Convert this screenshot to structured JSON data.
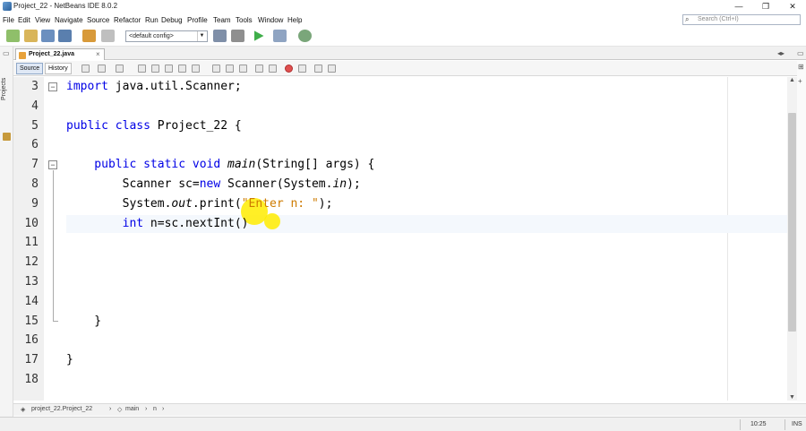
{
  "window": {
    "title": "Project_22 - NetBeans IDE 8.0.2",
    "minimize_glyph": "—",
    "restore_glyph": "❐",
    "close_glyph": "✕"
  },
  "menu": [
    "File",
    "Edit",
    "View",
    "Navigate",
    "Source",
    "Refactor",
    "Run",
    "Debug",
    "Profile",
    "Team",
    "Tools",
    "Window",
    "Help"
  ],
  "search": {
    "placeholder": "Search (Ctrl+I)"
  },
  "toolbar": {
    "config_value": "<default config>"
  },
  "sidebar": {
    "projects_label": "Projects"
  },
  "editor_tab": {
    "label": "Project_22.java",
    "close_glyph": "×"
  },
  "source_bar": {
    "source_label": "Source",
    "history_label": "History"
  },
  "code": {
    "line_numbers": [
      "3",
      "4",
      "5",
      "6",
      "7",
      "8",
      "9",
      "10",
      "11",
      "12",
      "13",
      "14",
      "15",
      "16",
      "17",
      "18"
    ],
    "lines": [
      [
        {
          "t": "import",
          "c": "kw"
        },
        {
          "t": " java.util.Scanner;",
          "c": ""
        }
      ],
      [],
      [
        {
          "t": "public class",
          "c": "kw"
        },
        {
          "t": " Project_22 {",
          "c": ""
        }
      ],
      [],
      [
        {
          "t": "    public static void",
          "c": "kw"
        },
        {
          "t": " ",
          "c": ""
        },
        {
          "t": "main",
          "c": "it"
        },
        {
          "t": "(String[] args) {",
          "c": ""
        }
      ],
      [
        {
          "t": "        Scanner sc=",
          "c": ""
        },
        {
          "t": "new",
          "c": "kw"
        },
        {
          "t": " Scanner(System.",
          "c": ""
        },
        {
          "t": "in",
          "c": "it"
        },
        {
          "t": ");",
          "c": ""
        }
      ],
      [
        {
          "t": "        System.",
          "c": ""
        },
        {
          "t": "out",
          "c": "it"
        },
        {
          "t": ".print(",
          "c": ""
        },
        {
          "t": "\"Enter n: \"",
          "c": "str"
        },
        {
          "t": ");",
          "c": ""
        }
      ],
      [
        {
          "t": "        int",
          "c": "kw"
        },
        {
          "t": " n=sc.nextInt()",
          "c": ""
        }
      ],
      [],
      [],
      [],
      [],
      [
        {
          "t": "    }",
          "c": ""
        }
      ],
      [],
      [
        {
          "t": "}",
          "c": ""
        }
      ],
      []
    ]
  },
  "breadcrumb": {
    "project": "project_22.Project_22",
    "method": "main",
    "more": "n"
  },
  "status": {
    "position": "10:25",
    "mode": "INS"
  }
}
